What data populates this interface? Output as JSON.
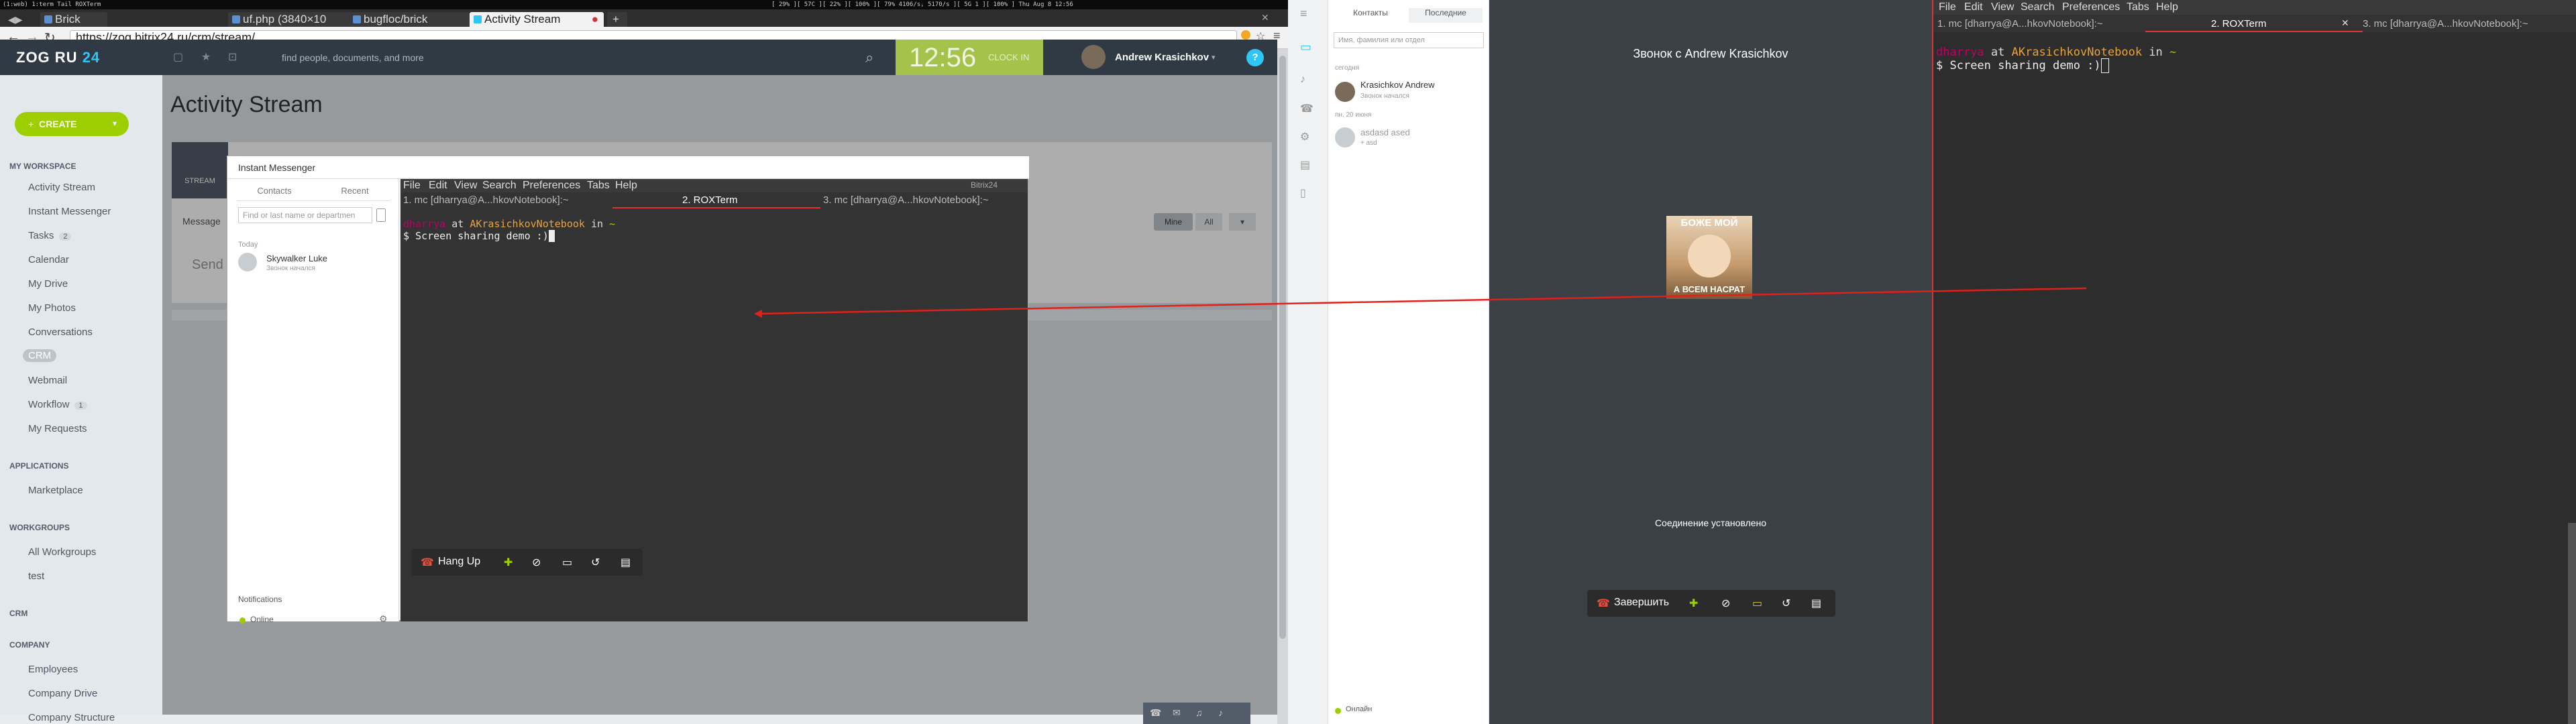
{
  "sysbar": {
    "left": "(1:web) 1:term  Tail  ROXTerm",
    "right": "[ 29% ][ 57C ][ 22% ][ 100% ][ 79% 4106/s, 5170/s ][ 5G 1 ][ 100% ] Thu Aug 8  12:56"
  },
  "browser": {
    "tabs": [
      {
        "label": "Brick"
      },
      {
        "label": "uf.php (3840×10"
      },
      {
        "label": "bugfloc/brick"
      },
      {
        "label": "Activity Stream"
      }
    ],
    "url": "https://zog.bitrix24.ru/crm/stream/"
  },
  "portal": {
    "logo_main": "ZOG RU",
    "logo_num": "24",
    "search_placeholder": "find people, documents, and more",
    "time": "12:56",
    "clock_out": "CLOCK IN",
    "user_name": "Andrew Krasichkov",
    "create_label": "CREATE",
    "page_title": "Activity Stream",
    "stream_label": "STREAM",
    "message_label": "Message",
    "send_label": "Send m",
    "filter_mine": "Mine",
    "filter_all": "All",
    "help": "?"
  },
  "sidebar": {
    "my_workspace": "MY WORKSPACE",
    "items1": [
      {
        "label": "Activity Stream"
      },
      {
        "label": "Instant Messenger"
      },
      {
        "label": "Tasks",
        "count": "2"
      },
      {
        "label": "Calendar"
      },
      {
        "label": "My Drive"
      },
      {
        "label": "My Photos"
      },
      {
        "label": "Conversations"
      },
      {
        "label": "CRM"
      },
      {
        "label": "Webmail"
      },
      {
        "label": "Workflow",
        "count": "1"
      },
      {
        "label": "My Requests"
      }
    ],
    "applications": "APPLICATIONS",
    "marketplace": "Marketplace",
    "workgroups": "WORKGROUPS",
    "all_workgroups": "All Workgroups",
    "test": "test",
    "crm": "CRM",
    "company": "COMPANY",
    "items2": [
      {
        "label": "Employees"
      },
      {
        "label": "Company Drive"
      },
      {
        "label": "Company Structure"
      }
    ]
  },
  "im": {
    "title": "Instant Messenger",
    "tab_contacts": "Contacts",
    "tab_recent": "Recent",
    "search_placeholder": "Find or last name or departmen",
    "today": "Today",
    "contact_name": "Skywalker Luke",
    "contact_status": "Звонок начался",
    "notifications": "Notifications",
    "online": "Online",
    "bitrix_brand": "Bitrix24",
    "hang_up": "Hang Up"
  },
  "terminal": {
    "menu": [
      "File",
      "Edit",
      "View",
      "Search",
      "Preferences",
      "Tabs",
      "Help"
    ],
    "tab1": "1. mc [dharrya@A...hkovNotebook]:~",
    "tab2": "2. ROXTerm",
    "tab3": "3. mc [dharrya@A...hkovNotebook]:~",
    "user": "dharrya",
    "at": " at ",
    "host": "AKrasichkovNotebook",
    "in": " in ",
    "path": "~",
    "prompt": "$ ",
    "command": "Screen sharing demo :)"
  },
  "desktop_messenger": {
    "tab_contacts": "Контакты",
    "tab_recent": "Последние",
    "search_placeholder": "Имя, фамилия или отдел",
    "section_today": "сегодня",
    "contact1_name": "Krasichkov Andrew",
    "contact1_status": "Звонок начался",
    "section2": "пн, 20 июня",
    "contact2_name": "asdasd ased",
    "contact2_status": "+ asd",
    "call_title": "Звонок с Andrew Krasichkov",
    "meme_top": "БОЖЕ МОЙ",
    "meme_bottom": "А ВСЕМ НАСРАТ",
    "connection_status": "Соединение установлено",
    "hang_up": "Завершить",
    "online": "Онлайн"
  }
}
